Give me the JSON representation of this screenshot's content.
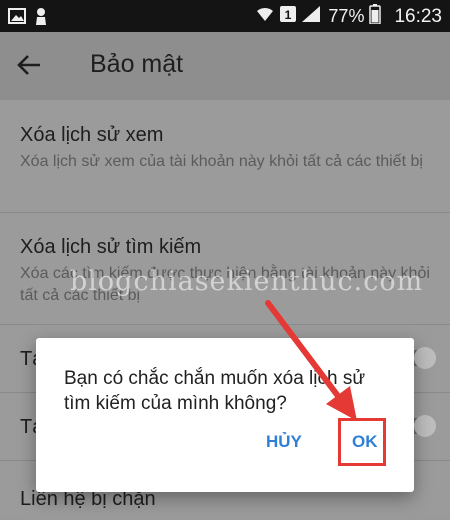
{
  "status_bar": {
    "sim_label": "1",
    "battery_percent": "77%",
    "time": "16:23"
  },
  "app_bar": {
    "title": "Bảo mật"
  },
  "settings": [
    {
      "title": "Xóa lịch sử xem",
      "desc": "Xóa lịch sử xem của tài khoản này khỏi tất cả các thiết bị"
    },
    {
      "title": "Xóa lịch sử tìm kiếm",
      "desc": "Xóa các tìm kiếm được thực hiện bằng tài khoản này khỏi tất cả các thiết bị"
    },
    {
      "title": "Tạ"
    },
    {
      "title": "Tạ"
    },
    {
      "title": "Liên hệ bị chặn"
    }
  ],
  "watermark": "blogchiasekienthuc.com",
  "dialog": {
    "message": "Bạn có chắc chắn muốn xóa lịch sử tìm kiếm của mình không?",
    "cancel_label": "HỦY",
    "ok_label": "OK"
  },
  "colors": {
    "accent": "#2f7fd6",
    "highlight": "#e53935"
  }
}
